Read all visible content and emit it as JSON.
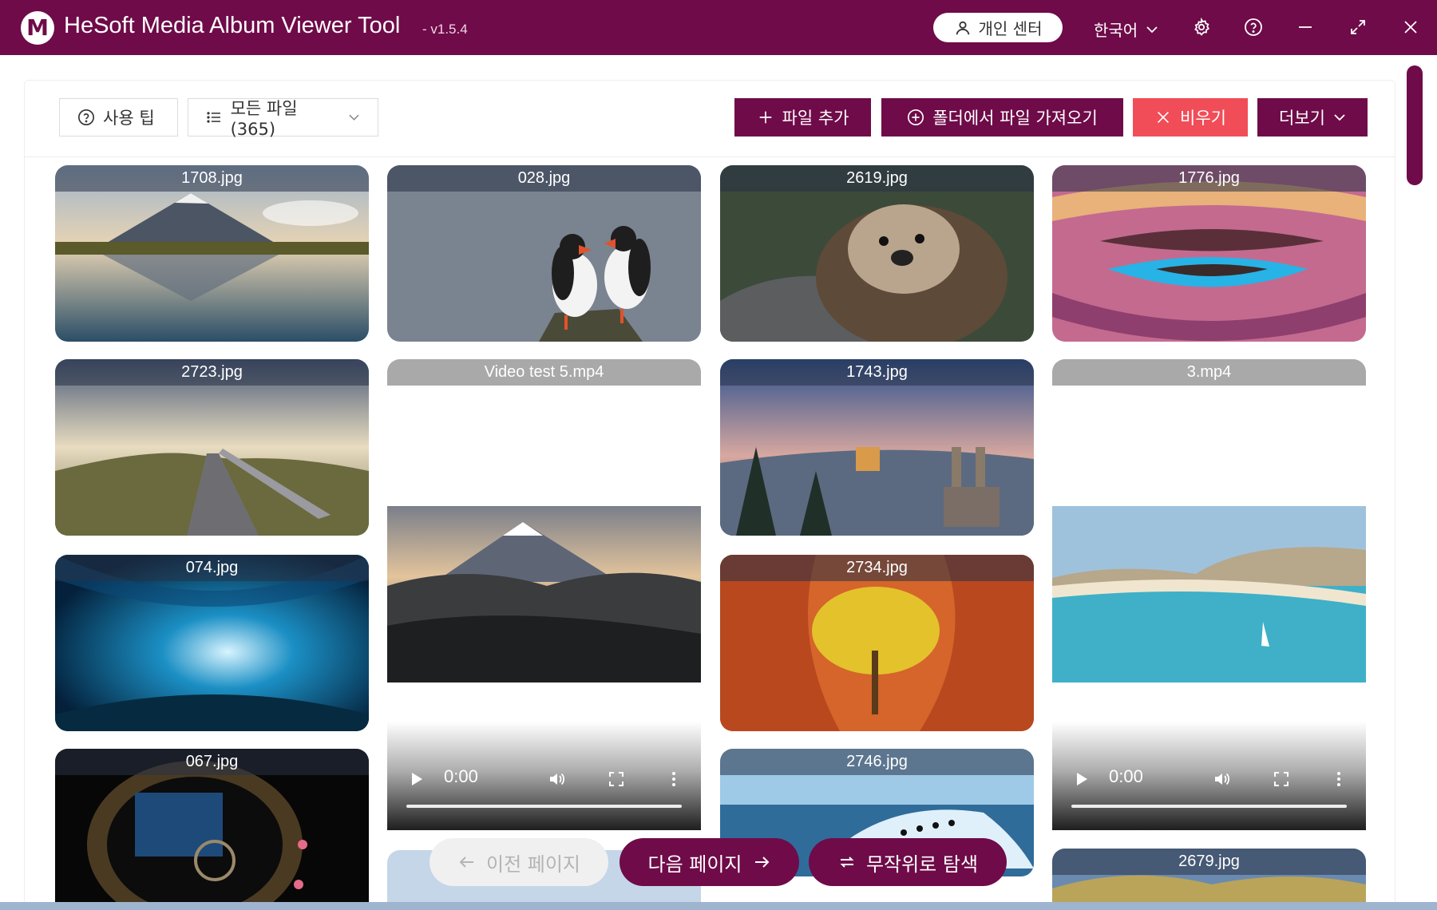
{
  "app": {
    "logo_letter": "M",
    "title": "HeSoft Media Album Viewer Tool",
    "version": "- v1.5.4",
    "user_center": "개인 센터",
    "language": "한국어"
  },
  "toolbar": {
    "tips_label": "사용 팁",
    "files_filter": "모든 파일 (365)",
    "add_file": "파일 추가",
    "import_folder": "폴더에서 파일 가져오기",
    "clear": "비우기",
    "more": "더보기"
  },
  "gallery": {
    "tiles": [
      {
        "label": "1708.jpg",
        "type": "image",
        "icon": "mountain-lake-photo"
      },
      {
        "label": "028.jpg",
        "type": "image",
        "icon": "puffins-photo"
      },
      {
        "label": "2619.jpg",
        "type": "image",
        "icon": "otter-photo"
      },
      {
        "label": "1776.jpg",
        "type": "image",
        "icon": "canyon-rock-photo"
      },
      {
        "label": "2723.jpg",
        "type": "image",
        "icon": "boardwalk-photo"
      },
      {
        "label": "Video test 5.mp4",
        "type": "video",
        "icon": "fuji-video-frame",
        "time": "0:00"
      },
      {
        "label": "1743.jpg",
        "type": "image",
        "icon": "winter-town-photo"
      },
      {
        "label": "3.mp4",
        "type": "video",
        "icon": "beach-video-frame",
        "time": "0:00"
      },
      {
        "label": "074.jpg",
        "type": "image",
        "icon": "ice-cave-photo"
      },
      {
        "label": "2734.jpg",
        "type": "image",
        "icon": "autumn-canyon-photo"
      },
      {
        "label": "067.jpg",
        "type": "image",
        "icon": "shipwreck-photo"
      },
      {
        "label": "2746.jpg",
        "type": "image",
        "icon": "penguins-iceberg-photo"
      },
      {
        "label": "2679.jpg",
        "type": "image",
        "icon": "hills-photo"
      }
    ]
  },
  "pager": {
    "prev": "이전 페이지",
    "next": "다음 페이지",
    "random": "무작위로 탐색"
  },
  "colors": {
    "brand": "#6f0b49",
    "danger": "#f14d58",
    "disabled": "#b4b4b4"
  }
}
